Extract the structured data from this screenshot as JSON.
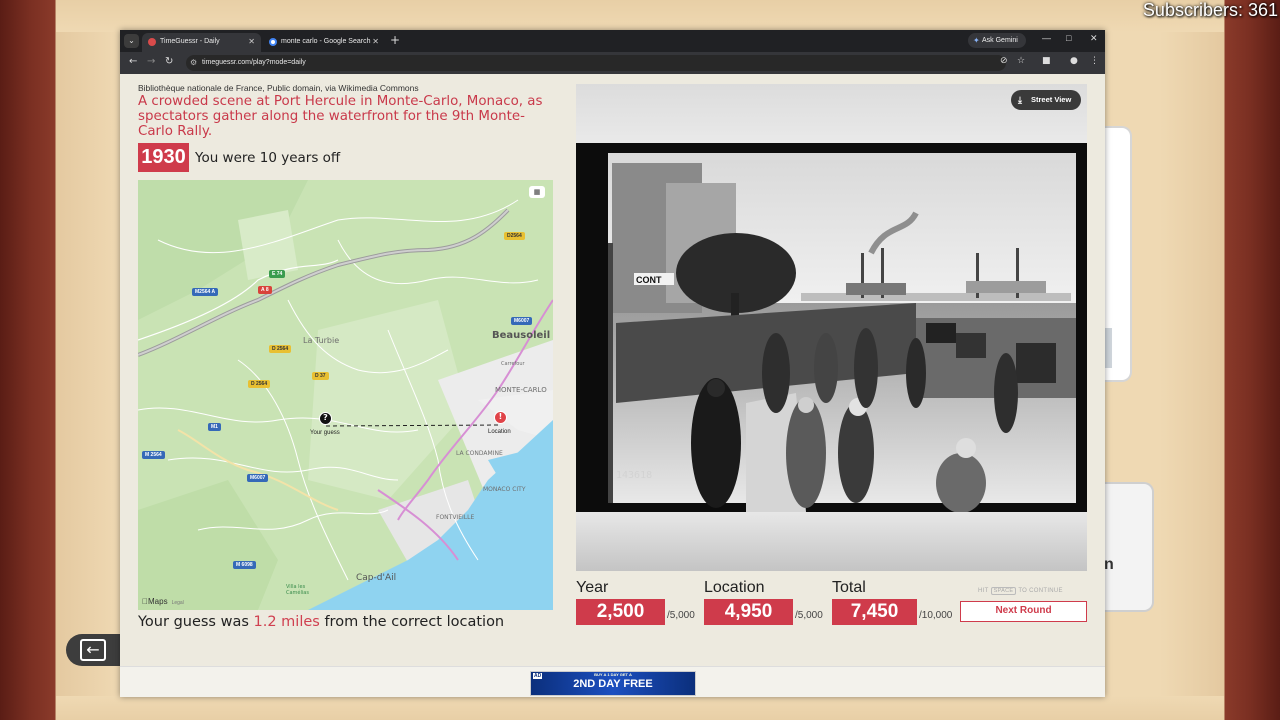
{
  "overlay": {
    "subscribers": "Subscribers: 361"
  },
  "browser": {
    "tabs": [
      {
        "label": "TimeGuessr - Daily",
        "active": true
      },
      {
        "label": "monte carlo - Google Search",
        "active": false
      }
    ],
    "gemini_label": "Ask Gemini",
    "url": "timeguessr.com/play?mode=daily"
  },
  "round": {
    "credit": "Bibliothèque nationale de France, Public domain, via Wikimedia Commons",
    "description": "A crowded scene at Port Hercule in Monte-Carlo, Monaco, as spectators gather along the waterfront for the 9th Monte-Carlo Rally.",
    "correct_year": "1930",
    "year_feedback": "You were 10 years off",
    "distance_prefix": "Your guess was ",
    "distance_value": "1.2 miles",
    "distance_suffix": " from the correct location"
  },
  "map": {
    "labels": {
      "la_turbie": "La Turbie",
      "beausoleil": "Beausoleil",
      "monte_carlo": "MONTE-CARLO",
      "la_condamine": "LA CONDAMINE",
      "monaco_city": "MONACO CITY",
      "fontvieille": "FONTVIEILLE",
      "cap_dail": "Cap-d'Ail",
      "villa": "Villa les\nCamélias",
      "carrefour": "Carrefour"
    },
    "road_badges": [
      "D2564",
      "M6007",
      "E 74",
      "A 8",
      "M2564 A",
      "D 2564",
      "D 37",
      "D 2564",
      "M6007",
      "M 2564",
      "M 6098",
      "M1"
    ],
    "guess_label": "Your guess",
    "location_label": "Location",
    "attribution": "Maps",
    "legal": "Legal"
  },
  "photo": {
    "street_view_label": "Street View",
    "sign_text": "CONT",
    "negative_code": "143618"
  },
  "scores": {
    "year": {
      "title": "Year",
      "value": "2,500",
      "max": "/5,000"
    },
    "location": {
      "title": "Location",
      "value": "4,950",
      "max": "/5,000"
    },
    "total": {
      "title": "Total",
      "value": "7,450",
      "max": "/10,000"
    }
  },
  "controls": {
    "hint_hit": "HIT",
    "hint_key": "SPACE",
    "hint_continue": "TO CONTINUE",
    "next_round": "Next Round"
  },
  "ad": {
    "label": "AD",
    "top_text": "BUY A 1 DAY GET A",
    "main_text": "2ND DAY FREE"
  },
  "side": {
    "card_letter": "n"
  },
  "colors": {
    "accent": "#cf3b4b",
    "map_land": "#c9e3b4",
    "sea": "#8fd3f0"
  }
}
